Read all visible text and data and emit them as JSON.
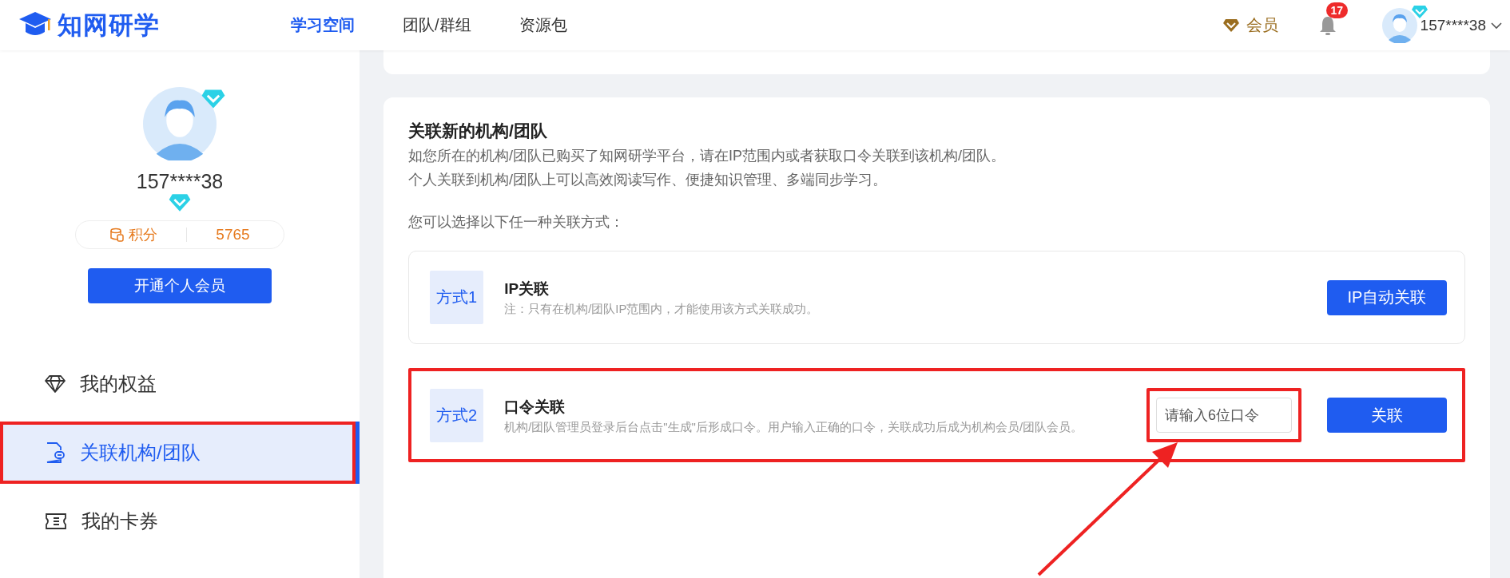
{
  "header": {
    "logo": "知网研学",
    "nav": [
      {
        "label": "学习空间",
        "selected": true
      },
      {
        "label": "团队/群组",
        "selected": false
      },
      {
        "label": "资源包",
        "selected": false
      }
    ],
    "member": "会员",
    "notifications": "17",
    "username": "157****38"
  },
  "sidebar": {
    "username": "157****38",
    "points_label": "积分",
    "points": "5765",
    "vip_button": "开通个人会员",
    "items": [
      {
        "label": "我的权益",
        "selected": false,
        "highlighted": false
      },
      {
        "label": "关联机构/团队",
        "selected": true,
        "highlighted": true
      },
      {
        "label": "我的卡券",
        "selected": false,
        "highlighted": false
      }
    ]
  },
  "card": {
    "title": "关联新的机构/团队",
    "lines": [
      "如您所在的机构/团队已购买了知网研学平台，请在IP范围内或者获取口令关联到该机构/团队。",
      "个人关联到机构/团队上可以高效阅读写作、便捷知识管理、多端同步学习。"
    ],
    "prompt": "您可以选择以下任一种关联方式：",
    "methods": [
      {
        "tag": "方式1",
        "title": "IP关联",
        "description": "注：只有在机构/团队IP范围内，才能使用该方式关联成功。",
        "kind": "button",
        "button": "IP自动关联",
        "highlighted": false
      },
      {
        "tag": "方式2",
        "title": "口令关联",
        "description": "机构/团队管理员登录后台点击\"生成\"后形成口令。用户输入正确的口令，关联成功后成为机构会员/团队会员。",
        "kind": "code",
        "placeholder": "请输入6位口令",
        "input_highlighted": true,
        "button": "关联",
        "highlighted": true
      }
    ]
  }
}
